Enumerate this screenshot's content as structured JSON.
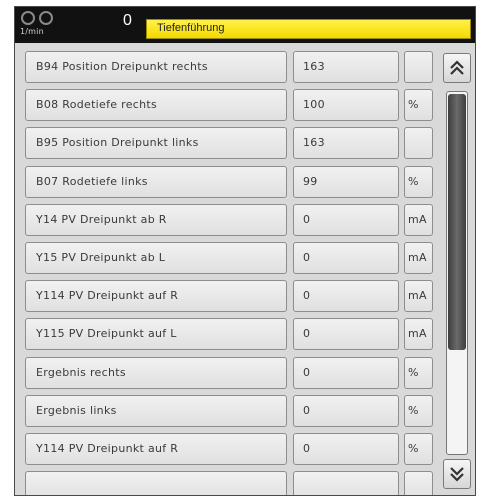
{
  "header": {
    "rpm_unit": "1/min",
    "rpm_value": "0",
    "title": "Tiefenführung"
  },
  "rows": [
    {
      "label": "B94 Position Dreipunkt rechts",
      "value": "163",
      "unit": ""
    },
    {
      "label": "B08 Rodetiefe rechts",
      "value": "100",
      "unit": "%"
    },
    {
      "label": "B95 Position Dreipunkt links",
      "value": "163",
      "unit": ""
    },
    {
      "label": "B07 Rodetiefe links",
      "value": "99",
      "unit": "%"
    },
    {
      "label": "Y14 PV Dreipunkt ab R",
      "value": "0",
      "unit": "mA"
    },
    {
      "label": "Y15 PV Dreipunkt ab L",
      "value": "0",
      "unit": "mA"
    },
    {
      "label": "Y114 PV Dreipunkt auf R",
      "value": "0",
      "unit": "mA"
    },
    {
      "label": "Y115 PV Dreipunkt auf L",
      "value": "0",
      "unit": "mA"
    },
    {
      "label": "Ergebnis rechts",
      "value": "0",
      "unit": "%"
    },
    {
      "label": "Ergebnis links",
      "value": "0",
      "unit": "%"
    },
    {
      "label": "Y114 PV Dreipunkt auf R",
      "value": "0",
      "unit": "%"
    },
    {
      "label": "",
      "value": "",
      "unit": ""
    }
  ],
  "icons": {
    "scroll_up": "double-chevron-up-icon",
    "scroll_down": "double-chevron-down-icon",
    "rpm": "gauge-icon"
  },
  "colors": {
    "title_bar": "#f4d900",
    "header_bg": "#111111",
    "scroll_thumb": "#4a4a4a"
  }
}
